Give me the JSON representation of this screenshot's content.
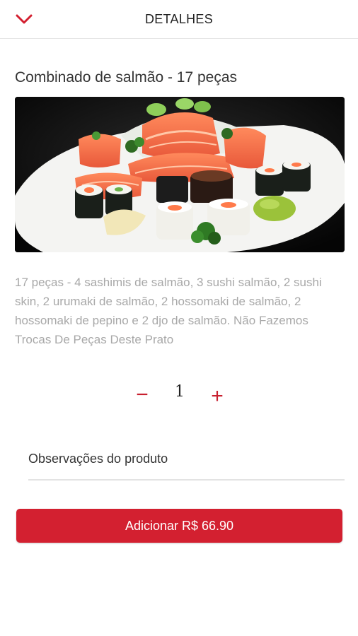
{
  "header": {
    "title": "DETALHES",
    "back_icon": "chevron-down-icon"
  },
  "product": {
    "title": "Combinado de salmão - 17 peças",
    "description": "17 peças - 4 sashimis de salmão, 3 sushi salmão, 2 sushi skin, 2 urumaki de salmão, 2 hossomaki de salmão, 2 hossomaki de pepino e 2 djo de salmão. Não Fazemos Trocas De Peças Deste Prato"
  },
  "quantity": {
    "minus_label": "−",
    "value": "1",
    "plus_label": "+"
  },
  "observations": {
    "placeholder": "Observações do produto"
  },
  "add_button": {
    "label": "Adicionar R$ 66.90"
  },
  "colors": {
    "accent": "#d32030",
    "description_text": "#a8a8a8",
    "divider": "#e6e6e6"
  }
}
